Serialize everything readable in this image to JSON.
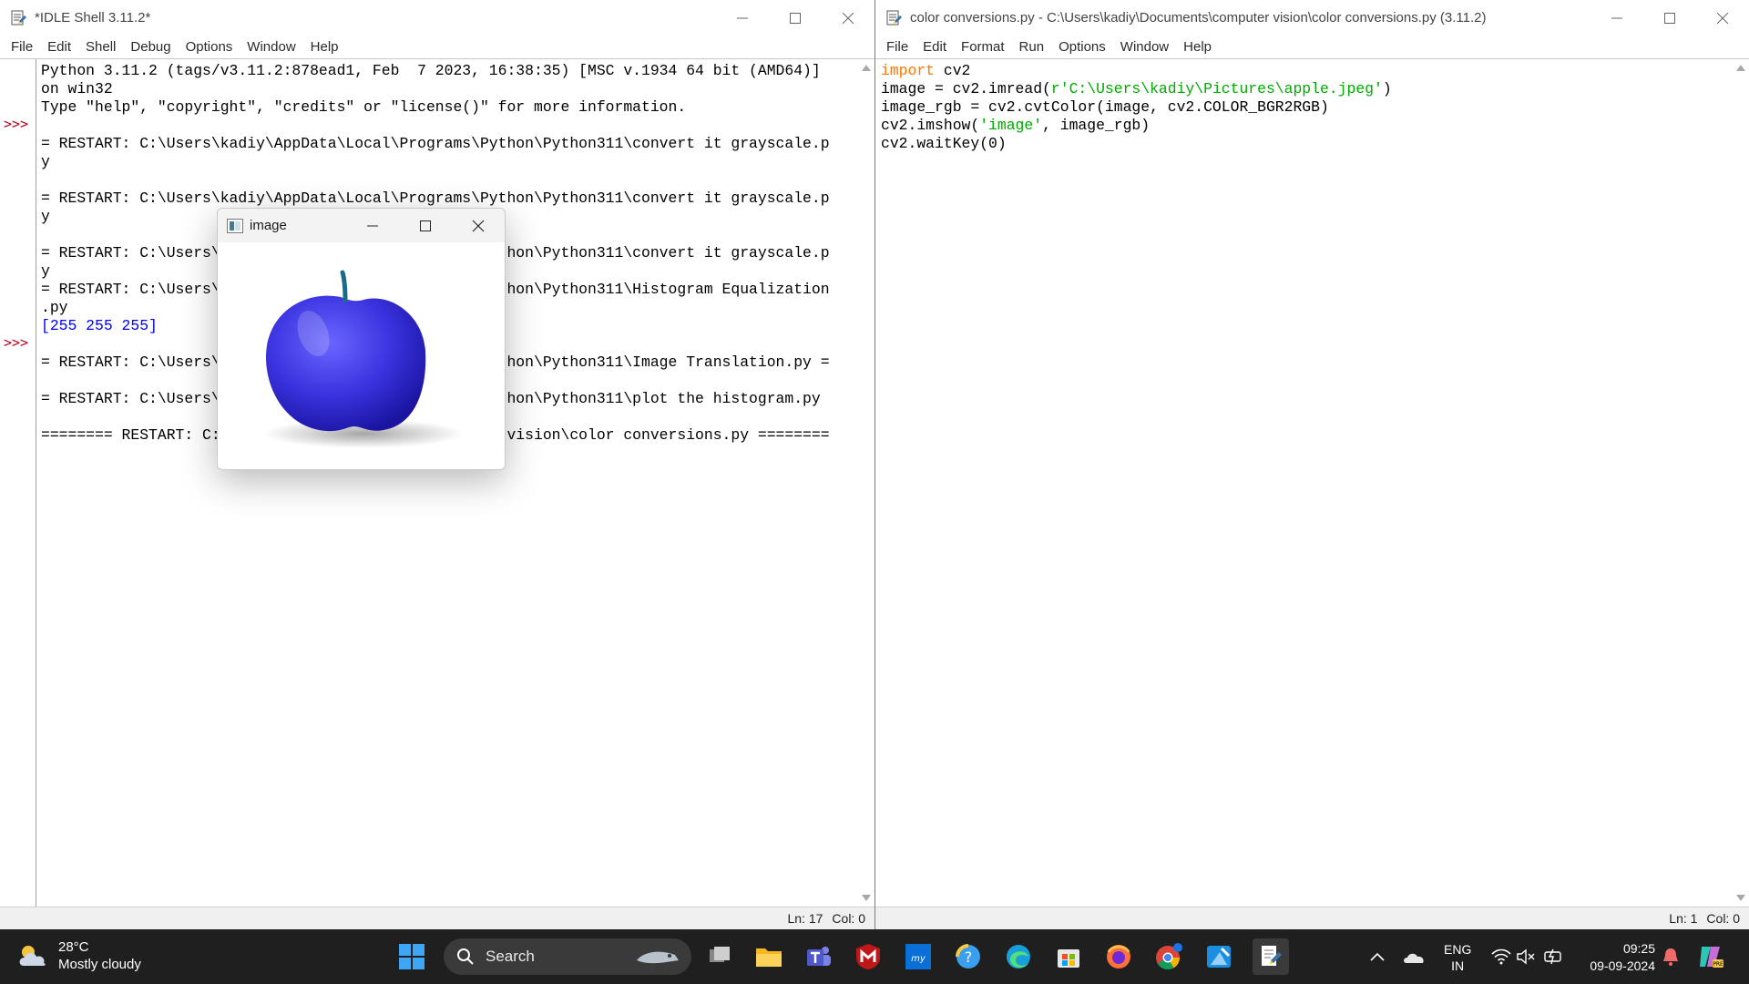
{
  "shell": {
    "title": "*IDLE Shell 3.11.2*",
    "menu": [
      "File",
      "Edit",
      "Shell",
      "Debug",
      "Options",
      "Window",
      "Help"
    ],
    "lines": [
      "Python 3.11.2 (tags/v3.11.2:878ead1, Feb  7 2023, 16:38:35) [MSC v.1934 64 bit (AMD64)]",
      "on win32",
      "Type \"help\", \"copyright\", \"credits\" or \"license()\" for more information.",
      "",
      "= RESTART: C:\\Users\\kadiy\\AppData\\Local\\Programs\\Python\\Python311\\convert it grayscale.p",
      "y",
      "",
      "= RESTART: C:\\Users\\kadiy\\AppData\\Local\\Programs\\Python\\Python311\\convert it grayscale.p",
      "y",
      "",
      "= RESTART: C:\\Users\\kadiy\\AppData\\Local\\Programs\\Python\\Python311\\convert it grayscale.p",
      "y",
      "= RESTART: C:\\Users\\kadiy\\AppData\\Local\\Programs\\Python\\Python311\\Histogram Equalization",
      ".py"
    ],
    "output_line": "[255 255 255]",
    "lines_after": [
      "",
      "= RESTART: C:\\Users\\kadiy\\AppData\\Local\\Programs\\Python\\Python311\\Image Translation.py =",
      "",
      "= RESTART: C:\\Users\\kadiy\\AppData\\Local\\Programs\\Python\\Python311\\plot the histogram.py",
      "",
      "======== RESTART: C:\\Users\\kadiy\\Documents\\computer vision\\color conversions.py ========"
    ],
    "prompt": ">>>",
    "status_ln": "Ln: 17",
    "status_col": "Col: 0"
  },
  "editor": {
    "title": "color conversions.py - C:\\Users\\kadiy\\Documents\\computer vision\\color conversions.py (3.11.2)",
    "menu": [
      "File",
      "Edit",
      "Format",
      "Run",
      "Options",
      "Window",
      "Help"
    ],
    "code": {
      "l1_kw": "import",
      "l1_rest": " cv2",
      "l2_pre": "image = cv2.imread(",
      "l2_str": "r'C:\\Users\\kadiy\\Pictures\\apple.jpeg'",
      "l2_post": ")",
      "l3": "image_rgb = cv2.cvtColor(image, cv2.COLOR_BGR2RGB)",
      "l4_pre": "cv2.imshow(",
      "l4_str": "'image'",
      "l4_post": ", image_rgb)",
      "l5": "cv2.waitKey(0)"
    },
    "status_ln": "Ln: 1",
    "status_col": "Col: 0"
  },
  "image_window": {
    "title": "image",
    "apple_color": "#3a33e0"
  },
  "taskbar": {
    "weather_temp": "28°C",
    "weather_desc": "Mostly cloudy",
    "search_label": "Search",
    "lang_1": "ENG",
    "lang_2": "IN",
    "time": "09:25",
    "date": "09-09-2024"
  }
}
